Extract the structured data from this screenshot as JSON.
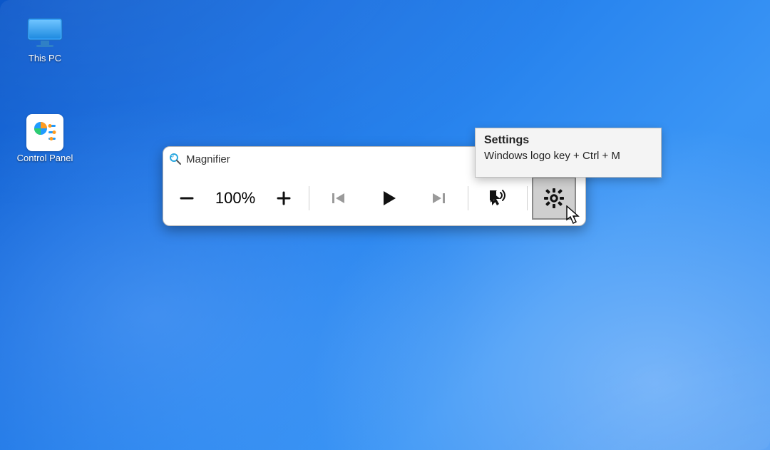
{
  "desktop": {
    "icons": [
      {
        "label": "This PC"
      },
      {
        "label": "Control Panel"
      }
    ]
  },
  "magnifier": {
    "title": "Magnifier",
    "zoom_value": "100%",
    "buttons": {
      "zoom_out": "−",
      "zoom_in": "+",
      "previous": "⏮",
      "play": "▶",
      "next": "⏭"
    }
  },
  "tooltip": {
    "title": "Settings",
    "shortcut": "Windows logo key + Ctrl + M"
  }
}
